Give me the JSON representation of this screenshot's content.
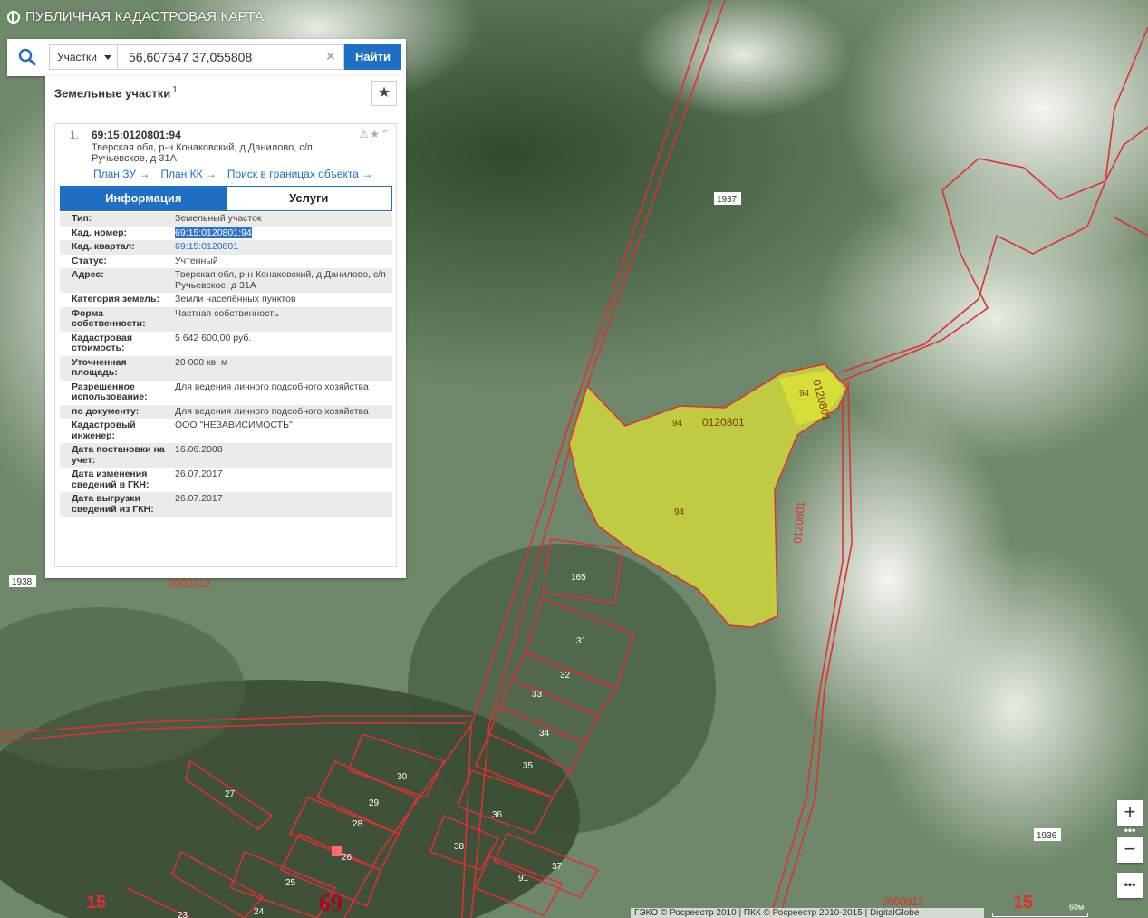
{
  "header": {
    "title": "ПУБЛИЧНАЯ КАДАСТРОВАЯ КАРТА"
  },
  "search": {
    "type_selected": "Участки",
    "query": "56,607547 37,055808",
    "submit_label": "Найти"
  },
  "panel": {
    "heading": "Земельные участки",
    "count": "1"
  },
  "result": {
    "index": "1.",
    "cad_number": "69:15:0120801:94",
    "address": "Тверская обл, р-н Конаковский, д Данилово, с/п Ручьевское, д 31А",
    "links": [
      "План ЗУ →",
      "План КК →",
      "Поиск в границах объекта →"
    ],
    "tabs": [
      "Информация",
      "Услуги"
    ],
    "rows": [
      {
        "key": "Тип:",
        "value": "Земельный участок"
      },
      {
        "key": "Кад. номер:",
        "value": "69:15:0120801:94"
      },
      {
        "key": "Кад. квартал:",
        "value": "69:15:0120801"
      },
      {
        "key": "Статус:",
        "value": "Учтенный"
      },
      {
        "key": "Адрес:",
        "value": "Тверская обл, р-н Конаковский, д Данилово, с/п Ручьевское, д 31А"
      },
      {
        "key": "Категория земель:",
        "value": "Земли населённых пунктов"
      },
      {
        "key": "Форма собственности:",
        "value": "Частная собственность"
      },
      {
        "key": "Кадастровая стоимость:",
        "value": "5 642 600,00 руб."
      },
      {
        "key": "Уточненная площадь:",
        "value": "20 000 кв. м"
      },
      {
        "key": "Разрешенное использование:",
        "value": "Для ведения личного подсобного хозяйства"
      },
      {
        "key": "по документу:",
        "value": "Для ведения личного подсобного хозяйства"
      },
      {
        "key": "Кадастровый инженер:",
        "value": "ООО \"НЕЗАВИСИМОСТЬ\""
      },
      {
        "key": "Дата постановки на учет:",
        "value": "16.06.2008"
      },
      {
        "key": "Дата изменения сведений в ГКН:",
        "value": "26.07.2017"
      },
      {
        "key": "Дата выгрузки сведений из ГКН:",
        "value": "26.07.2017"
      }
    ]
  },
  "map": {
    "labels": {
      "q1937": "1937",
      "q1938": "1938",
      "q1936": "1936",
      "q0000012a": "0000012",
      "q0000012b": "0000012",
      "q0120801a": "0120801",
      "q0120801b": "0120801",
      "q0120801c": "0120801",
      "p94a": "94",
      "p94b": "94",
      "p94c": "94",
      "p165": "165",
      "p31": "31",
      "p32": "32",
      "p33": "33",
      "p34": "34",
      "p35": "35",
      "p36": "36",
      "p37": "37",
      "p38": "38",
      "p91": "91",
      "p30": "30",
      "p29": "29",
      "p28": "28",
      "p27": "27",
      "p26": "26",
      "p25": "25",
      "p24": "24",
      "p23": "23",
      "region15a": "15",
      "region15b": "15",
      "region69": "69"
    },
    "attribution": "ГЭКО © Росреестр 2010 | ПКК © Росреестр 2010-2015 | DigitalGlobe",
    "scale": "60м",
    "zoom_in": "+",
    "zoom_out": "−",
    "more": "•••",
    "colors": {
      "parcel_fill": "#d9e236",
      "boundary": "#e03030",
      "accent": "#1f6fc4"
    }
  }
}
